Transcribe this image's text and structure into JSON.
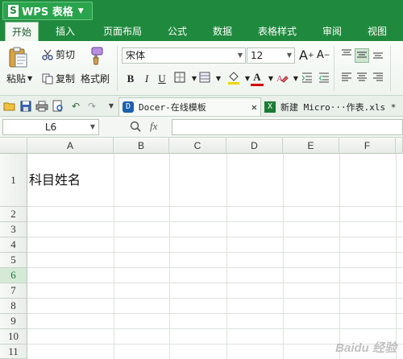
{
  "app": {
    "title": "WPS 表格",
    "logo_letter": "S"
  },
  "menu": {
    "tabs": [
      {
        "label": "开始",
        "active": true
      },
      {
        "label": "插入"
      },
      {
        "label": "页面布局"
      },
      {
        "label": "公式"
      },
      {
        "label": "数据"
      },
      {
        "label": "表格样式"
      },
      {
        "label": "审阅"
      },
      {
        "label": "视图"
      }
    ]
  },
  "ribbon": {
    "paste_label": "粘贴",
    "cut_label": "剪切",
    "copy_label": "复制",
    "format_painter_label": "格式刷",
    "font_name": "宋体",
    "font_size": "12",
    "grow_font": "A",
    "shrink_font": "A",
    "bold": "B",
    "italic": "I",
    "underline": "U",
    "font_color_letter": "A"
  },
  "doc_tabs": [
    {
      "label": "Docer-在线模板"
    },
    {
      "label": "新建 Micro···作表.xls *"
    }
  ],
  "formula_bar": {
    "name_box": "L6",
    "fx_label": "fx"
  },
  "sheet": {
    "columns": [
      "A",
      "B",
      "C",
      "D",
      "E",
      "F"
    ],
    "rows": [
      "1",
      "2",
      "3",
      "4",
      "5",
      "6",
      "7",
      "8",
      "9",
      "10",
      "11"
    ],
    "active_row": "6",
    "cells": {
      "A1": "科目姓名"
    }
  },
  "watermark": "Baidu 经验",
  "colors": {
    "brand": "#1f8a3d",
    "active_tab_bg": "#f3f8f3",
    "font_color_bar": "#d40000",
    "highlight_bar": "#f2d600"
  }
}
